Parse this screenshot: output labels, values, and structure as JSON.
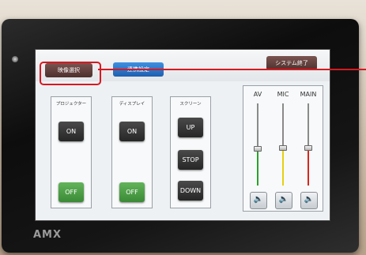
{
  "device": {
    "brand": "AMX"
  },
  "tabs": {
    "image_select": "映像選択",
    "link_settings": "連携設定",
    "system_end": "システム終了"
  },
  "panels": {
    "projector": {
      "title": "プロジェクター",
      "on": "ON",
      "off": "OFF"
    },
    "display": {
      "title": "ディスプレイ",
      "on": "ON",
      "off": "OFF"
    },
    "screen": {
      "title": "スクリーン",
      "up": "UP",
      "stop": "STOP",
      "down": "DOWN"
    }
  },
  "audio": {
    "channels": [
      {
        "label": "AV",
        "color": "#2e9e2e",
        "level": 0.45
      },
      {
        "label": "MIC",
        "color": "#e8cf10",
        "level": 0.46
      },
      {
        "label": "MAIN",
        "color": "#d8271d",
        "level": 0.46
      }
    ],
    "mute_icon": "speaker-icon"
  },
  "colors": {
    "highlight": "#d71920",
    "on_green": "#4ea046",
    "tab_blue": "#2f7fd6"
  }
}
